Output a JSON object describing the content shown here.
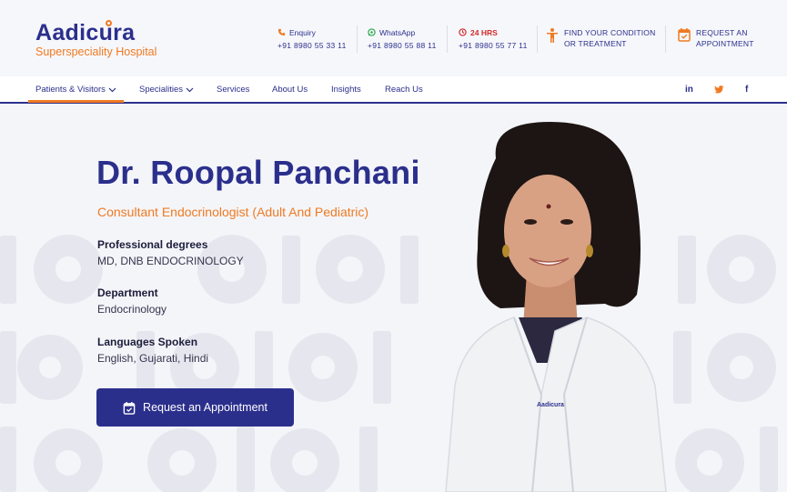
{
  "logo": {
    "name": "Aadicura",
    "tagline": "Superspeciality Hospital"
  },
  "contacts": [
    {
      "label": "Enquiry",
      "number": "+91 8980 55 33 11",
      "icon": "phone-icon"
    },
    {
      "label": "WhatsApp",
      "number": "+91 8980 55 88 11",
      "icon": "whatsapp-icon"
    },
    {
      "label": "24 HRS",
      "number": "+91 8980 55 77 11",
      "icon": "clock-icon"
    }
  ],
  "header_ctas": {
    "find_condition": {
      "line1": "FIND YOUR CONDITION",
      "line2": "OR TREATMENT"
    },
    "request_appointment": {
      "line1": "REQUEST AN",
      "line2": "APPOINTMENT"
    }
  },
  "nav": {
    "items": [
      "Patients & Visitors",
      "Specialities",
      "Services",
      "About Us",
      "Insights",
      "Reach Us"
    ],
    "social": {
      "linkedin": "in",
      "twitter": "twitter",
      "facebook": "f"
    }
  },
  "doctor": {
    "name": "Dr. Roopal Panchani",
    "title": "Consultant Endocrinologist (Adult And Pediatric)",
    "fields": [
      {
        "label": "Professional degrees",
        "value": "MD, DNB ENDOCRINOLOGY"
      },
      {
        "label": "Department",
        "value": "Endocrinology"
      },
      {
        "label": "Languages Spoken",
        "value": "English, Gujarati, Hindi"
      }
    ],
    "button_label": "Request an Appointment",
    "coat_logo": "Aadicura"
  },
  "colors": {
    "brand_blue": "#2b2f8c",
    "brand_orange": "#f07a21",
    "alert_red": "#d32b2b"
  }
}
